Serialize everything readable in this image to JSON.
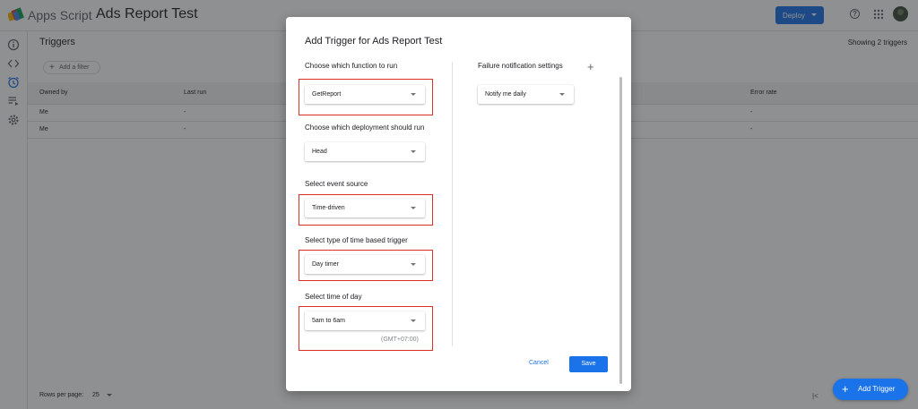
{
  "app": {
    "name": "Apps Script",
    "project": "Ads Report Test"
  },
  "toolbar": {
    "deploy_label": "Deploy"
  },
  "nav": {
    "overview_icon": "info-icon",
    "editor_icon": "code-icon",
    "triggers_icon": "alarm-icon",
    "executions_icon": "executions-icon",
    "settings_icon": "gear-icon"
  },
  "triggers": {
    "title": "Triggers",
    "showing": "Showing 2 triggers",
    "filter_label": "Add a filter",
    "columns": [
      "Owned by",
      "Last run",
      "Error rate"
    ],
    "rows": [
      {
        "owner": "Me",
        "last_run": "-",
        "error_rate": "-"
      },
      {
        "owner": "Me",
        "last_run": "-",
        "error_rate": "-"
      }
    ],
    "rows_per_page_label": "Rows per page:",
    "rows_per_page_value": "25",
    "pager_label": "|<",
    "add_trigger_label": "Add Trigger"
  },
  "dialog": {
    "title": "Add Trigger for Ads Report Test",
    "function_label": "Choose which function to run",
    "function_value": "GetReport",
    "deployment_label": "Choose which deployment should run",
    "deployment_value": "Head",
    "event_source_label": "Select event source",
    "event_source_value": "Time-driven",
    "trigger_type_label": "Select type of time based trigger",
    "trigger_type_value": "Day timer",
    "time_of_day_label": "Select time of day",
    "time_of_day_value": "5am to 6am",
    "timezone": "(GMT+07:00)",
    "failure_label": "Failure notification settings",
    "failure_value": "Notify me daily",
    "cancel_label": "Cancel",
    "save_label": "Save"
  },
  "colors": {
    "accent": "#1a73e8",
    "highlight": "#d93025",
    "overlay": "#202124"
  }
}
